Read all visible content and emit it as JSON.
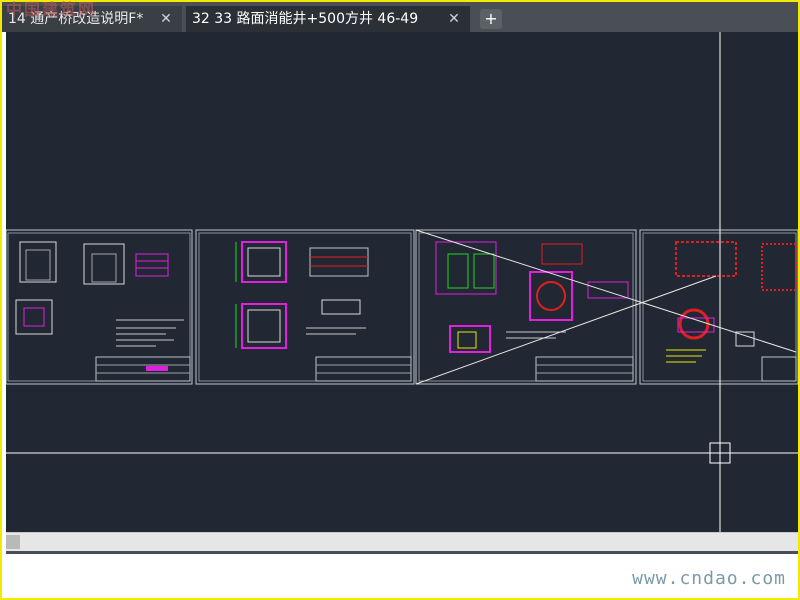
{
  "tabs": [
    {
      "label": "14 通产桥改造说明F*",
      "close": "✕",
      "active": false
    },
    {
      "label": "32 33 路面消能井+500方井 46-49",
      "close": "✕",
      "active": true
    }
  ],
  "new_tab_label": "+",
  "watermark_top": "中国建筑网",
  "watermark_bottom": "www.cndao.com",
  "colors": {
    "canvas_bg": "#222833",
    "tabbar_bg": "#4a4f56",
    "frame": "#f2ea00",
    "sheet_line": "#bfc4cb",
    "magenta": "#e01fe0",
    "green": "#22d422",
    "red": "#e02020",
    "yellow": "#e6e600",
    "crosshair": "#ffffff"
  },
  "icons": {
    "close": "close-icon",
    "add": "plus-icon",
    "cursor": "crosshair-cursor-icon"
  }
}
